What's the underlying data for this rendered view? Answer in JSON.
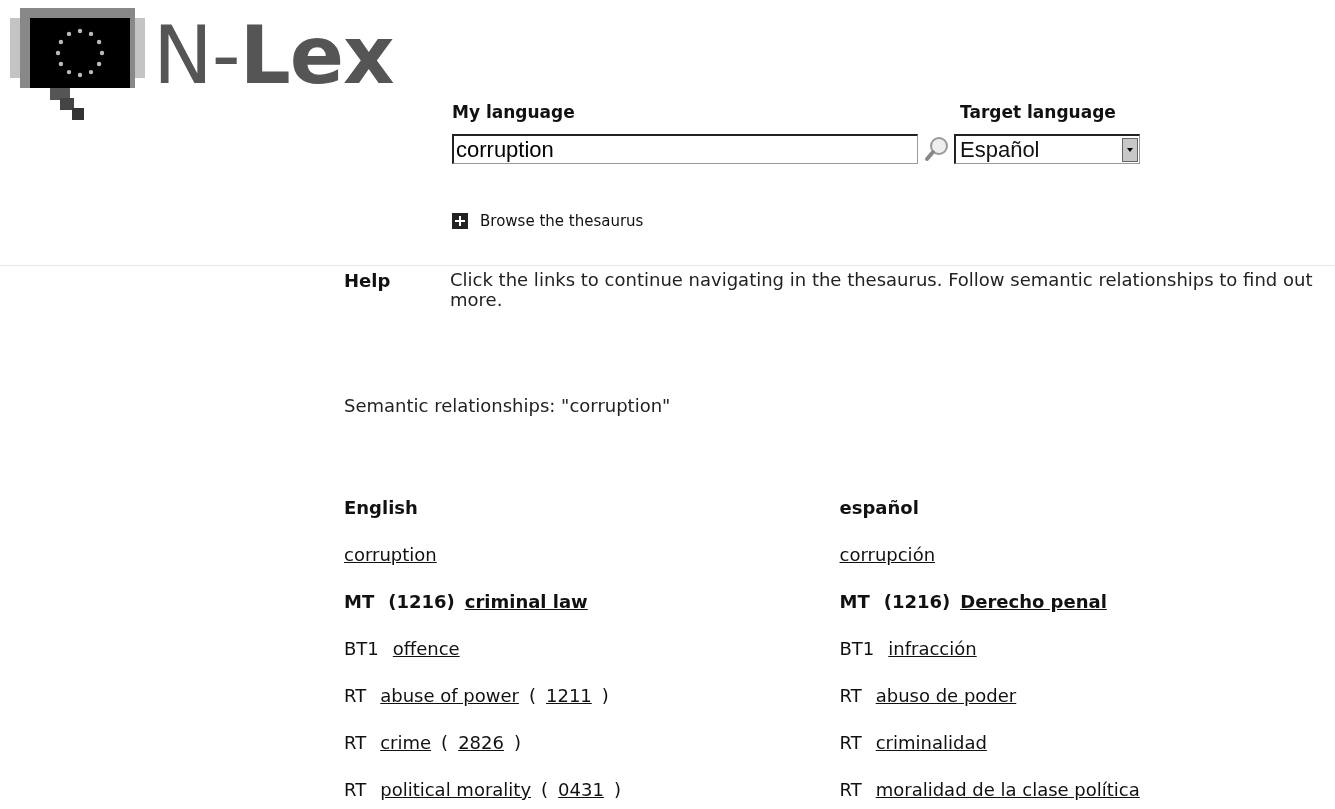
{
  "logo": {
    "text": "N-**Lex**"
  },
  "search": {
    "my_language_label": "My language",
    "query": "corruption",
    "target_language_label": "Target language",
    "target_language": "Español",
    "browse_link": "Browse the thesaurus"
  },
  "help": {
    "label": "Help",
    "text": "Click the links to continue navigating in the thesaurus. Follow semantic relationships to find out more."
  },
  "relationships_title": "Semantic relationships: \"corruption\"",
  "columns": [
    {
      "heading": "English",
      "rows": [
        {
          "bold": false,
          "parts": [
            {
              "kind": "link",
              "text": "corruption"
            }
          ]
        },
        {
          "bold": true,
          "parts": [
            {
              "kind": "tag",
              "text": "MT"
            },
            {
              "kind": "plain",
              "text": "(1216)"
            },
            {
              "kind": "link",
              "text": "criminal law"
            }
          ]
        },
        {
          "bold": false,
          "parts": [
            {
              "kind": "tag",
              "text": "BT1"
            },
            {
              "kind": "link",
              "text": "offence"
            }
          ]
        },
        {
          "bold": false,
          "parts": [
            {
              "kind": "tag",
              "text": "RT"
            },
            {
              "kind": "link",
              "text": "abuse of power"
            },
            {
              "kind": "plain",
              "text": "("
            },
            {
              "kind": "link",
              "text": "1211"
            },
            {
              "kind": "plain",
              "text": ")"
            }
          ]
        },
        {
          "bold": false,
          "parts": [
            {
              "kind": "tag",
              "text": "RT"
            },
            {
              "kind": "link",
              "text": "crime"
            },
            {
              "kind": "plain",
              "text": "("
            },
            {
              "kind": "link",
              "text": "2826"
            },
            {
              "kind": "plain",
              "text": ")"
            }
          ]
        },
        {
          "bold": false,
          "parts": [
            {
              "kind": "tag",
              "text": "RT"
            },
            {
              "kind": "link",
              "text": "political morality"
            },
            {
              "kind": "plain",
              "text": "("
            },
            {
              "kind": "link",
              "text": "0431"
            },
            {
              "kind": "plain",
              "text": ")"
            }
          ]
        }
      ]
    },
    {
      "heading": "español",
      "rows": [
        {
          "bold": false,
          "parts": [
            {
              "kind": "link",
              "text": "corrupción"
            }
          ]
        },
        {
          "bold": true,
          "parts": [
            {
              "kind": "tag",
              "text": "MT"
            },
            {
              "kind": "plain",
              "text": "(1216)"
            },
            {
              "kind": "link",
              "text": "Derecho penal"
            }
          ]
        },
        {
          "bold": false,
          "parts": [
            {
              "kind": "tag",
              "text": "BT1"
            },
            {
              "kind": "link",
              "text": "infracción"
            }
          ]
        },
        {
          "bold": false,
          "parts": [
            {
              "kind": "tag",
              "text": "RT"
            },
            {
              "kind": "link",
              "text": "abuso de poder"
            }
          ]
        },
        {
          "bold": false,
          "parts": [
            {
              "kind": "tag",
              "text": "RT"
            },
            {
              "kind": "link",
              "text": "criminalidad"
            }
          ]
        },
        {
          "bold": false,
          "parts": [
            {
              "kind": "tag",
              "text": "RT"
            },
            {
              "kind": "link",
              "text": "moralidad de la clase política"
            }
          ]
        }
      ]
    }
  ]
}
